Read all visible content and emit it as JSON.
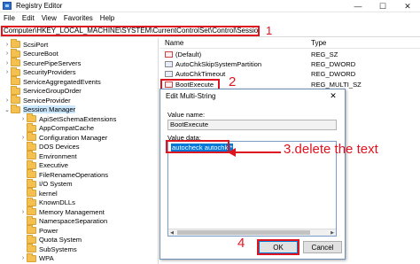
{
  "window": {
    "title": "Registry Editor",
    "minimize": "—",
    "maximize": "☐",
    "close": "✕"
  },
  "menu": [
    "File",
    "Edit",
    "View",
    "Favorites",
    "Help"
  ],
  "address": "Computer\\HKEY_LOCAL_MACHINE\\SYSTEM\\CurrentControlSet\\Control\\Session Manager",
  "annotations": {
    "step1": "1",
    "step2": "2",
    "step3": "3.delete the text",
    "step4": "4",
    "color": "#e0141f"
  },
  "tree": {
    "items": [
      {
        "label": "ScsiPort",
        "chevron": "›",
        "level": 1
      },
      {
        "label": "SecureBoot",
        "chevron": "›",
        "level": 1
      },
      {
        "label": "SecurePipeServers",
        "chevron": "›",
        "level": 1
      },
      {
        "label": "SecurityProviders",
        "chevron": "›",
        "level": 1
      },
      {
        "label": "ServiceAggregatedEvents",
        "chevron": "",
        "level": 1
      },
      {
        "label": "ServiceGroupOrder",
        "chevron": "",
        "level": 1
      },
      {
        "label": "ServiceProvider",
        "chevron": "›",
        "level": 1
      },
      {
        "label": "Session Manager",
        "chevron": "⌄",
        "level": 1,
        "selected": true
      },
      {
        "label": "ApiSetSchemaExtensions",
        "chevron": "›",
        "level": 2
      },
      {
        "label": "AppCompatCache",
        "chevron": "",
        "level": 2
      },
      {
        "label": "Configuration Manager",
        "chevron": "›",
        "level": 2
      },
      {
        "label": "DOS Devices",
        "chevron": "",
        "level": 2
      },
      {
        "label": "Environment",
        "chevron": "",
        "level": 2
      },
      {
        "label": "Executive",
        "chevron": "",
        "level": 2
      },
      {
        "label": "FileRenameOperations",
        "chevron": "",
        "level": 2
      },
      {
        "label": "I/O System",
        "chevron": "",
        "level": 2
      },
      {
        "label": "kernel",
        "chevron": "",
        "level": 2
      },
      {
        "label": "KnownDLLs",
        "chevron": "",
        "level": 2
      },
      {
        "label": "Memory Management",
        "chevron": "›",
        "level": 2
      },
      {
        "label": "NamespaceSeparation",
        "chevron": "",
        "level": 2
      },
      {
        "label": "Power",
        "chevron": "",
        "level": 2
      },
      {
        "label": "Quota System",
        "chevron": "",
        "level": 2
      },
      {
        "label": "SubSystems",
        "chevron": "",
        "level": 2
      },
      {
        "label": "WPA",
        "chevron": "›",
        "level": 2
      }
    ]
  },
  "list": {
    "columns": {
      "name": "Name",
      "type": "Type"
    },
    "rows": [
      {
        "name": "(Default)",
        "type": "REG_SZ",
        "icon": "string-value-icon"
      },
      {
        "name": "AutoChkSkipSystemPartition",
        "type": "REG_DWORD",
        "icon": "binary-value-icon"
      },
      {
        "name": "AutoChkTimeout",
        "type": "REG_DWORD",
        "icon": "binary-value-icon"
      },
      {
        "name": "BootExecute",
        "type": "REG_MULTI_SZ",
        "icon": "string-value-icon"
      }
    ]
  },
  "dialog": {
    "title": "Edit Multi-String",
    "close": "✕",
    "value_name_label": "Value name:",
    "value_name": "BootExecute",
    "value_data_label": "Value data:",
    "value_data": "autocheck autochk *",
    "ok_label": "OK",
    "cancel_label": "Cancel"
  }
}
